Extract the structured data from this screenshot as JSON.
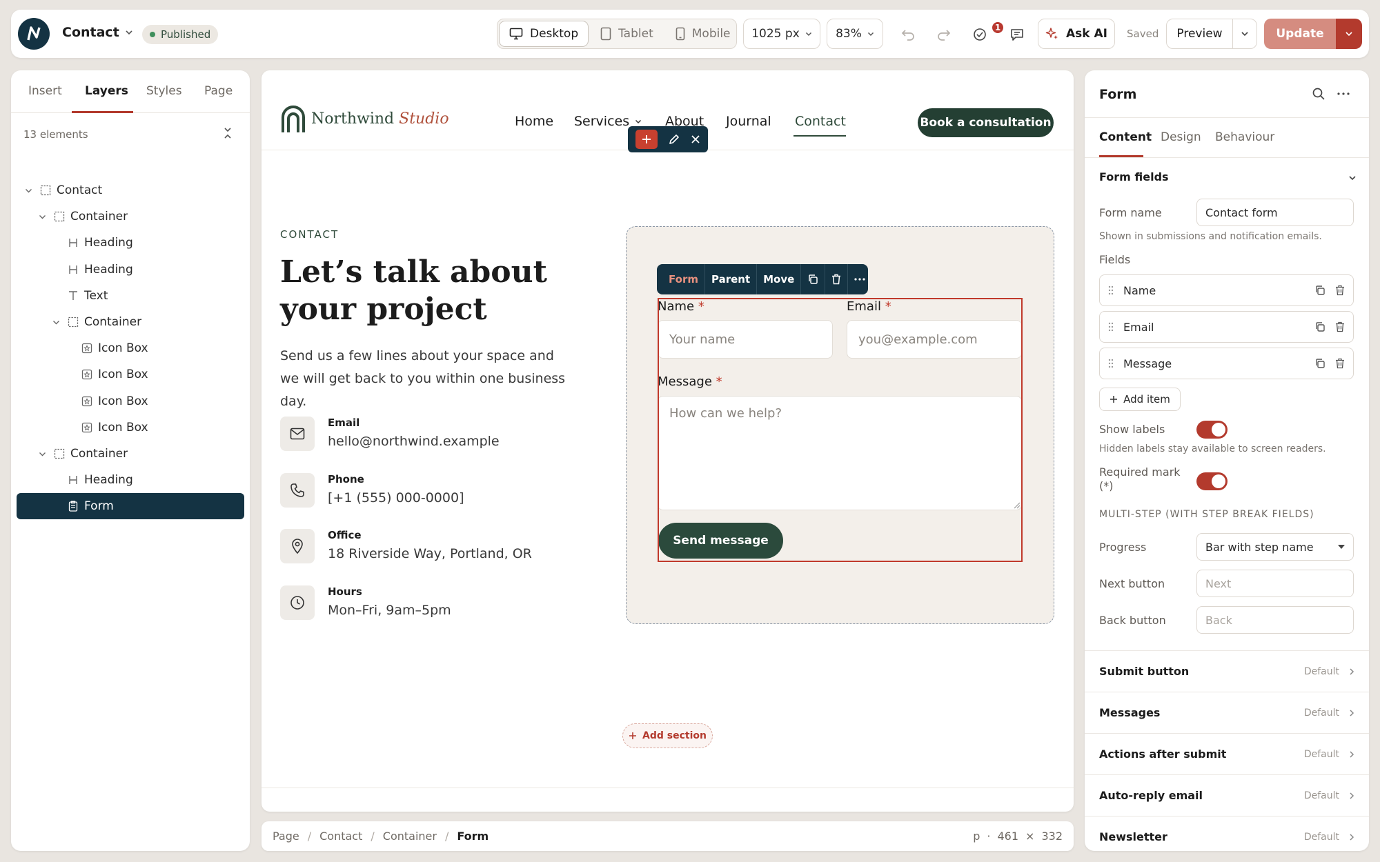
{
  "topbar": {
    "page_name": "Contact",
    "status": "Published",
    "devices": [
      "Desktop",
      "Tablet",
      "Mobile"
    ],
    "width": "1025 px",
    "zoom": "83%",
    "notifications": "1",
    "ask_ai": "Ask AI",
    "saved": "Saved",
    "preview": "Preview",
    "update": "Update"
  },
  "left": {
    "tabs": [
      "Insert",
      "Layers",
      "Styles",
      "Page"
    ],
    "count": "13 elements",
    "tree": [
      {
        "label": "Contact",
        "icon": "container"
      },
      {
        "label": "Container",
        "icon": "container"
      },
      {
        "label": "Heading",
        "icon": "heading"
      },
      {
        "label": "Heading",
        "icon": "heading"
      },
      {
        "label": "Text",
        "icon": "text"
      },
      {
        "label": "Container",
        "icon": "container"
      },
      {
        "label": "Icon Box",
        "icon": "iconbox"
      },
      {
        "label": "Icon Box",
        "icon": "iconbox"
      },
      {
        "label": "Icon Box",
        "icon": "iconbox"
      },
      {
        "label": "Icon Box",
        "icon": "iconbox"
      },
      {
        "label": "Container",
        "icon": "container"
      },
      {
        "label": "Heading",
        "icon": "heading"
      },
      {
        "label": "Form",
        "icon": "form"
      }
    ]
  },
  "site": {
    "brand_a": "Northwind",
    "brand_b": "Studio",
    "nav": [
      "Home",
      "Services",
      "About",
      "Journal",
      "Contact"
    ],
    "cta": "Book a consultation",
    "eyebrow": "CONTACT",
    "heading": "Let’s talk about your project",
    "lead": "Send us a few lines about your space and we will get back to you within one business day.",
    "contacts": [
      {
        "label": "Email",
        "value": "hello@northwind.example"
      },
      {
        "label": "Phone",
        "value": "[+1 (555) 000-0000]"
      },
      {
        "label": "Office",
        "value": "18 Riverside Way, Portland, OR"
      },
      {
        "label": "Hours",
        "value": "Mon–Fri, 9am–5pm"
      }
    ],
    "form": {
      "toolbar": [
        "Form",
        "Parent",
        "Move"
      ],
      "name_label": "Name",
      "email_label": "Email",
      "message_label": "Message",
      "required": "*",
      "name_ph": "Your name",
      "email_ph": "you@example.com",
      "message_ph": "How can we help?",
      "submit": "Send message"
    },
    "add_section": "Add section"
  },
  "breadcrumb": {
    "items": [
      "Page",
      "Contact",
      "Container"
    ],
    "current": "Form",
    "tag": "p",
    "w": "461",
    "times": "×",
    "h": "332"
  },
  "right": {
    "title": "Form",
    "tabs": [
      "Content",
      "Design",
      "Behaviour"
    ],
    "section": "Form fields",
    "form_name_label": "Form name",
    "form_name_value": "Contact form",
    "form_name_help": "Shown in submissions and notification emails.",
    "fields_label": "Fields",
    "fields": [
      "Name",
      "Email",
      "Message"
    ],
    "add_item": "Add item",
    "show_labels": "Show labels",
    "show_labels_help": "Hidden labels stay available to screen readers.",
    "required_mark": "Required mark (*)",
    "multistep": "MULTI-STEP (WITH STEP BREAK FIELDS)",
    "progress_label": "Progress",
    "progress_value": "Bar with step name",
    "next_label": "Next button",
    "next_ph": "Next",
    "back_label": "Back button",
    "back_ph": "Back",
    "accordions": [
      {
        "title": "Submit button",
        "value": "Default"
      },
      {
        "title": "Messages",
        "value": "Default"
      },
      {
        "title": "Actions after submit",
        "value": "Default"
      },
      {
        "title": "Auto-reply email",
        "value": "Default"
      },
      {
        "title": "Newsletter",
        "value": "Default"
      }
    ]
  },
  "colors": {
    "accent": "#b33a2d",
    "navy": "#143343",
    "green": "#2b4a3c"
  }
}
